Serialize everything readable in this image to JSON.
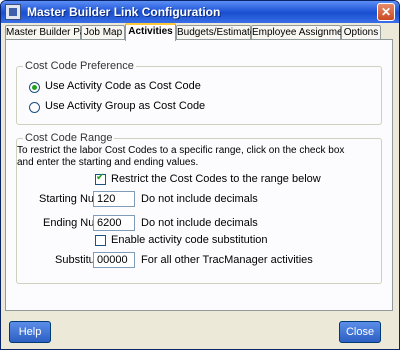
{
  "window": {
    "title": "Master Builder Link Configuration"
  },
  "tabs": [
    {
      "label": "Master Builder Path"
    },
    {
      "label": "Job Map"
    },
    {
      "label": "Activities"
    },
    {
      "label": "Budgets/Estimates"
    },
    {
      "label": "Employee Assignments"
    },
    {
      "label": "Options"
    }
  ],
  "cost_code_preference": {
    "title": "Cost Code Preference",
    "options": [
      {
        "label": "Use Activity Code as Cost Code",
        "selected": true
      },
      {
        "label": "Use Activity Group as Cost Code",
        "selected": false
      }
    ]
  },
  "cost_code_range": {
    "title": "Cost Code Range",
    "description_line1": "To restrict the labor Cost Codes to a specific range, click on the check box",
    "description_line2": "and enter the starting and ending values.",
    "restrict_label": "Restrict the Cost Codes to the range below",
    "restrict_checked": true,
    "starting_label": "Starting Number",
    "starting_value": "120",
    "starting_hint": "Do not include decimals",
    "ending_label": "Ending Number",
    "ending_value": "6200",
    "ending_hint": "Do not include decimals",
    "substitution_label": "Enable activity code substitution",
    "substitution_checked": false,
    "substitute_label": "Substitute",
    "substitute_value": "00000",
    "substitute_hint": "For all other TracManager activities"
  },
  "buttons": {
    "help": "Help",
    "close": "Close"
  },
  "close_glyph": "✕"
}
